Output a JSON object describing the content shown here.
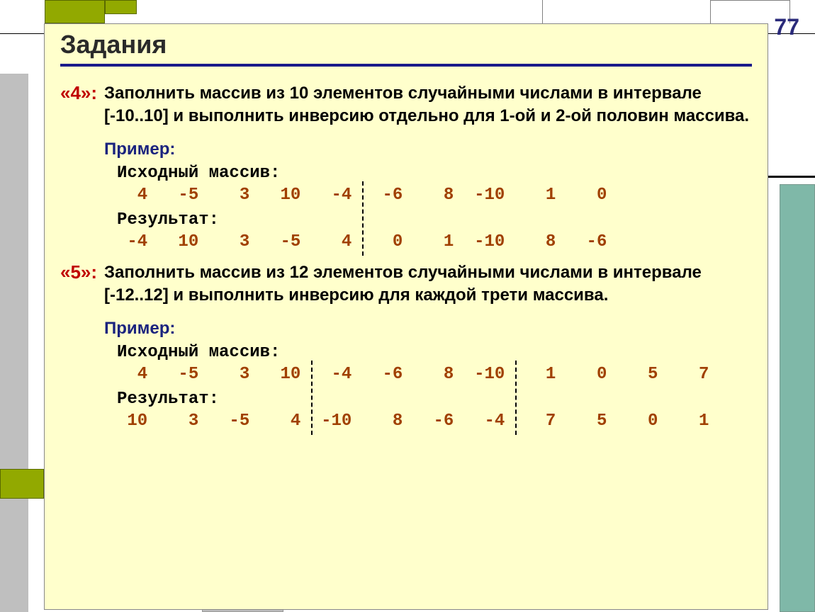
{
  "page_number": "77",
  "title": "Задания",
  "tasks": [
    {
      "grade": "«4»:",
      "description": "Заполнить  массив из 10 элементов случайными числами в интервале [-10..10] и выполнить  инверсию отдельно для 1-ой и 2-ой половин массива.",
      "example_label": "Пример:",
      "source_label": "Исходный массив:",
      "source_arr": [
        "4",
        "-5",
        "3",
        "10",
        "-4",
        "-6",
        "8",
        "-10",
        "1",
        "0"
      ],
      "result_label": "Результат:",
      "result_arr": [
        "-4",
        "10",
        "3",
        "-5",
        "4",
        "0",
        "1",
        "-10",
        "8",
        "-6"
      ],
      "dividers": [
        5
      ]
    },
    {
      "grade": "«5»:",
      "description": "Заполнить  массив из 12 элементов случайными числами в интервале [-12..12] и выполнить  инверсию для каждой трети массива.",
      "example_label": "Пример:",
      "source_label": "Исходный массив:",
      "source_arr": [
        "4",
        "-5",
        "3",
        "10",
        "-4",
        "-6",
        "8",
        "-10",
        "1",
        "0",
        "5",
        "7"
      ],
      "result_label": "Результат:",
      "result_arr": [
        "10",
        "3",
        "-5",
        "4",
        "-10",
        "8",
        "-6",
        "-4",
        "7",
        "5",
        "0",
        "1"
      ],
      "dividers": [
        4,
        8
      ]
    }
  ]
}
